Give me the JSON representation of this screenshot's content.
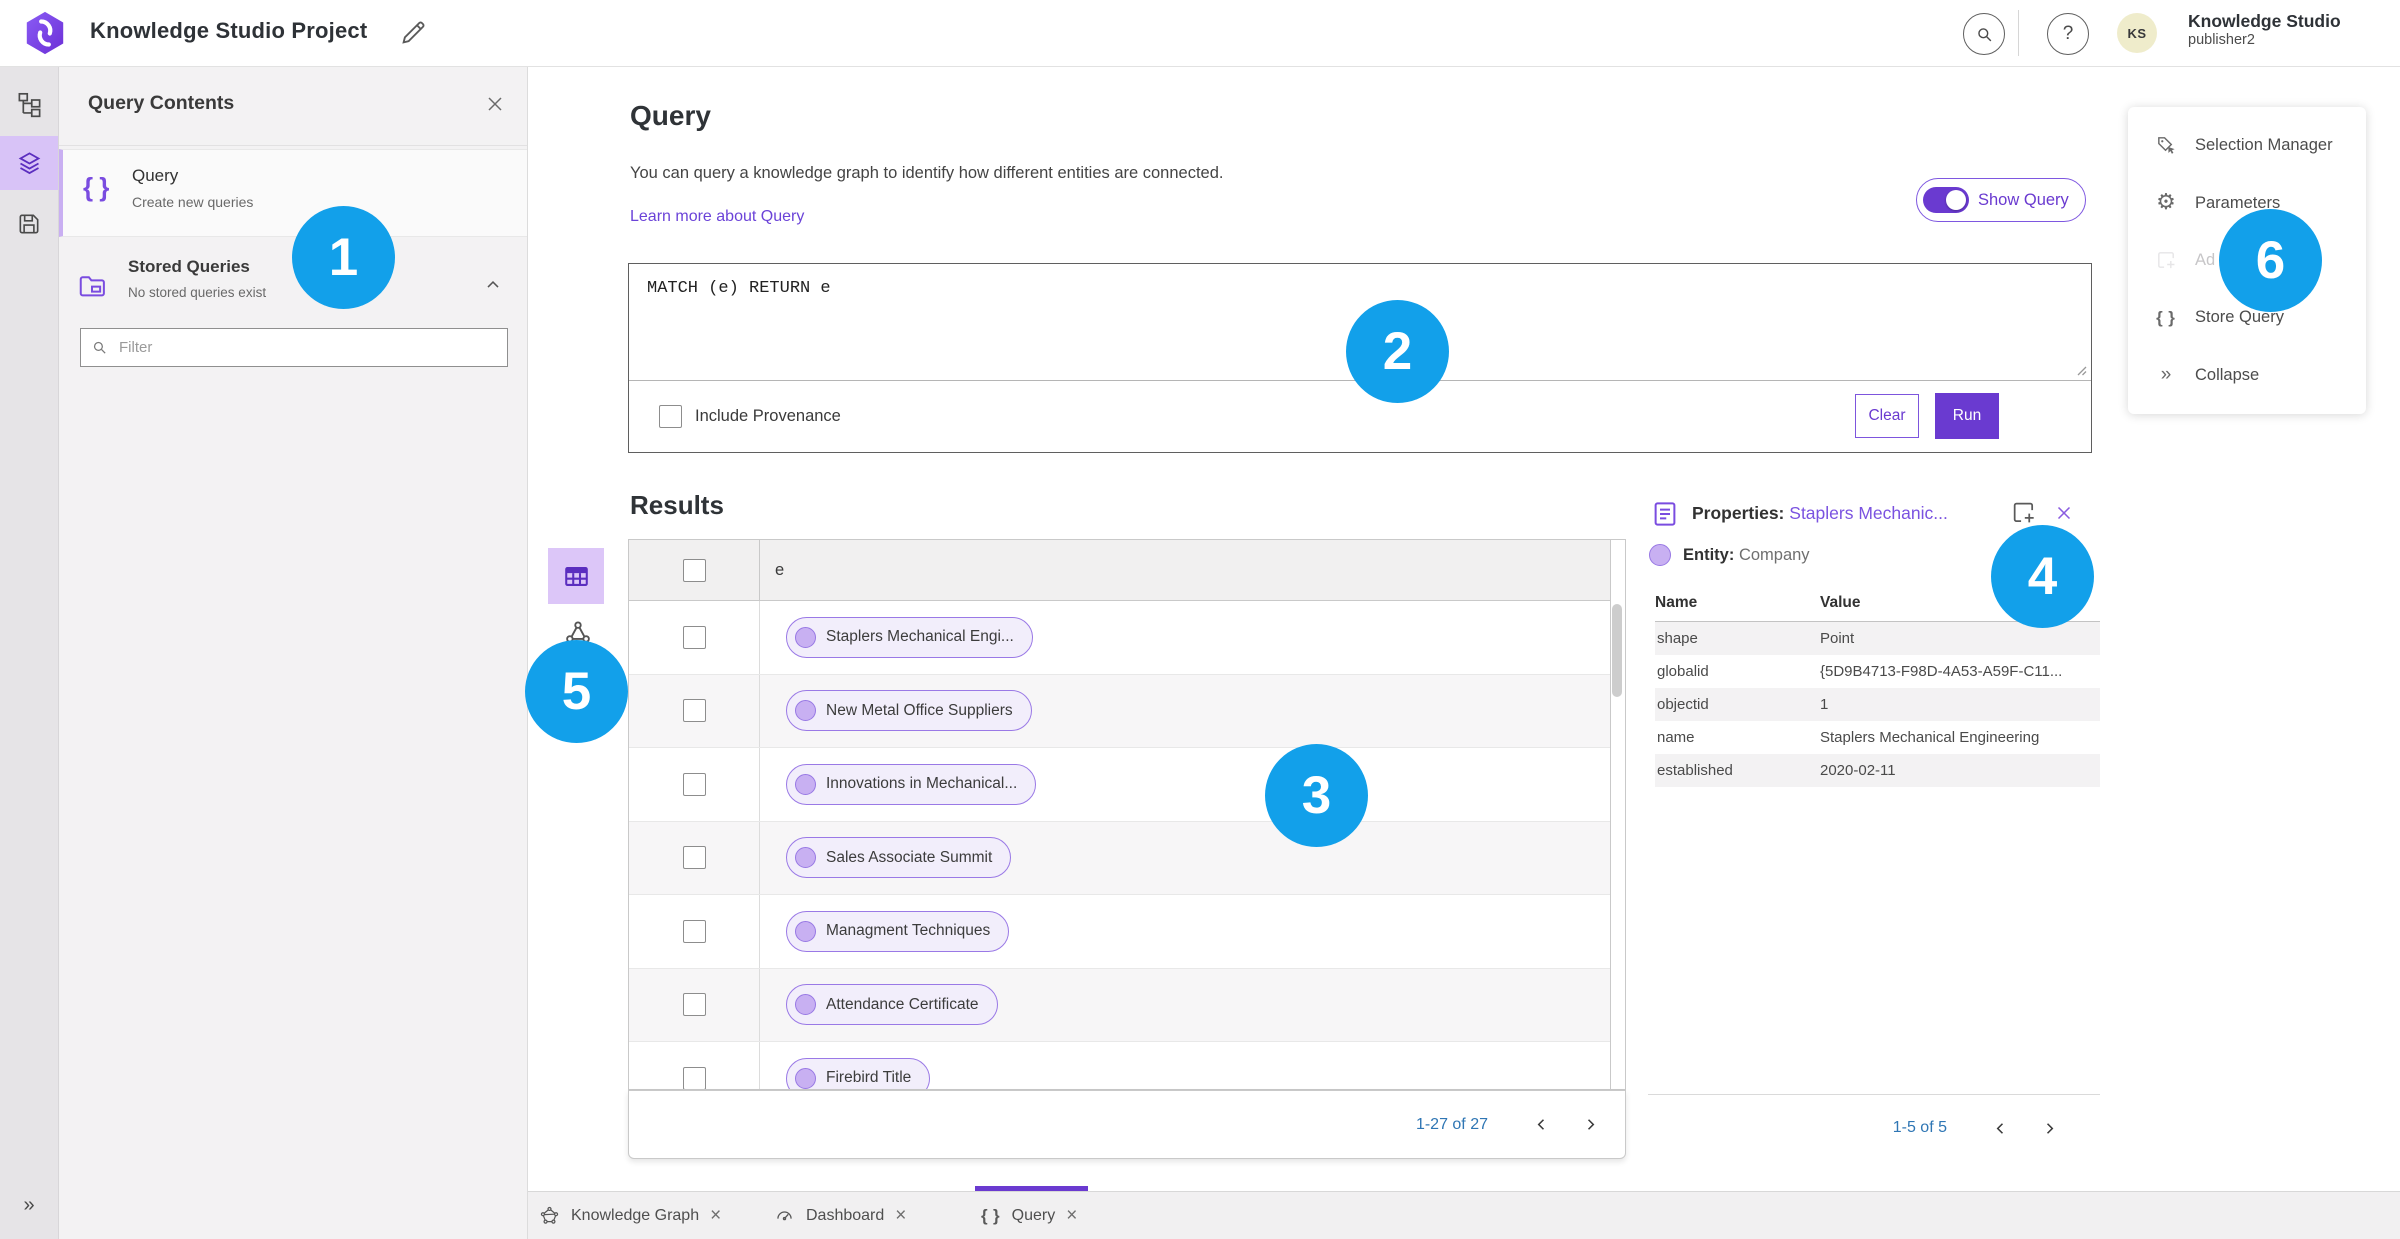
{
  "topbar": {
    "title": "Knowledge Studio Project",
    "user": {
      "initials": "KS",
      "name": "Knowledge Studio",
      "role": "publisher2"
    }
  },
  "rail": {
    "icons": [
      "data-model-icon",
      "layers-icon",
      "save-icon",
      "double-chevron-right-icon"
    ]
  },
  "contents_panel": {
    "title": "Query Contents",
    "query_item": {
      "label": "Query",
      "sublabel": "Create new queries"
    },
    "stored_queries": {
      "label": "Stored Queries",
      "sublabel": "No stored queries exist"
    },
    "filter_placeholder": "Filter"
  },
  "query_section": {
    "heading": "Query",
    "description": "You can query a knowledge graph to identify how different entities are connected.",
    "learn_more_link": "Learn more about Query",
    "show_query_label": "Show Query",
    "query_text": "MATCH (e) RETURN e",
    "include_provenance_label": "Include Provenance",
    "clear_button": "Clear",
    "run_button": "Run"
  },
  "results": {
    "heading": "Results",
    "column_header": "e",
    "rows": [
      {
        "label": "Staplers Mechanical Engi..."
      },
      {
        "label": "New Metal Office Suppliers"
      },
      {
        "label": "Innovations in Mechanical..."
      },
      {
        "label": "Sales Associate Summit"
      },
      {
        "label": "Managment Techniques"
      },
      {
        "label": "Attendance Certificate"
      },
      {
        "label": "Firebird Title"
      }
    ],
    "pagination": "1-27 of 27"
  },
  "properties_panel": {
    "title_prefix": "Properties:",
    "title_entity": "Staplers Mechanic...",
    "entity_label": "Entity:",
    "entity_type": "Company",
    "columns": [
      "Name",
      "Value"
    ],
    "rows": [
      [
        "shape",
        "Point"
      ],
      [
        "globalid",
        "{5D9B4713-F98D-4A53-A59F-C11..."
      ],
      [
        "objectid",
        "1"
      ],
      [
        "name",
        "Staplers Mechanical Engineering"
      ],
      [
        "established",
        "2020-02-11"
      ]
    ],
    "pagination": "1-5 of 5"
  },
  "actions_panel": {
    "items": [
      {
        "label": "Selection Manager",
        "icon": "selection-manager-icon",
        "disabled": false
      },
      {
        "label": "Parameters",
        "icon": "gear-icon",
        "disabled": false
      },
      {
        "label": "Ad",
        "icon": "add-to-new-icon",
        "disabled": true
      },
      {
        "label": "Store Query",
        "icon": "braces-icon",
        "disabled": false
      },
      {
        "label": "Collapse",
        "icon": "double-chevron-right-icon",
        "disabled": false
      }
    ]
  },
  "bottom_tabs": [
    {
      "label": "Knowledge Graph",
      "icon": "network-icon",
      "active": false
    },
    {
      "label": "Dashboard",
      "icon": "gauge-icon",
      "active": false
    },
    {
      "label": "Query",
      "icon": "braces-icon",
      "active": true
    }
  ],
  "annotations": [
    "1",
    "2",
    "3",
    "4",
    "5",
    "6"
  ],
  "colors": {
    "accent_purple": "#6a3ad0",
    "light_purple": "#d8c3f7",
    "pill_fill": "#f2eefb",
    "pill_border": "#9a79e6",
    "annotation_blue": "#12a0ea",
    "avatar_yellow": "#efeccb",
    "pagination_blue": "#2f76b4"
  }
}
